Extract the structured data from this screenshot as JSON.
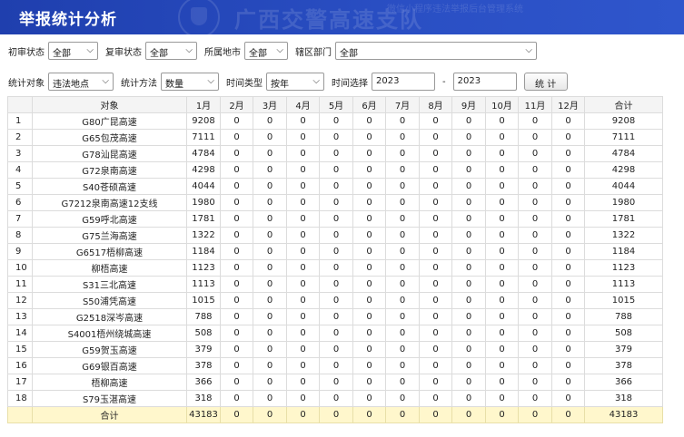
{
  "header": {
    "title": "举报统计分析",
    "watermark": "广西交警高速支队",
    "watermark_sub": "微信小程序违法举报后台管理系统"
  },
  "filters": {
    "initial_review_label": "初审状态",
    "initial_review_value": "全部",
    "re_review_label": "复审状态",
    "re_review_value": "全部",
    "city_label": "所属地市",
    "city_value": "全部",
    "dept_label": "辖区部门",
    "dept_value": "全部",
    "object_label": "统计对象",
    "object_value": "违法地点",
    "method_label": "统计方法",
    "method_value": "数量",
    "time_type_label": "时间类型",
    "time_type_value": "按年",
    "time_select_label": "时间选择",
    "time_from": "2023",
    "time_separator": "-",
    "time_to": "2023",
    "stat_button": "统 计"
  },
  "table": {
    "headers": [
      "",
      "对象",
      "1月",
      "2月",
      "3月",
      "4月",
      "5月",
      "6月",
      "7月",
      "8月",
      "9月",
      "10月",
      "11月",
      "12月",
      "合计"
    ],
    "rows": [
      [
        "1",
        "G80广昆高速",
        "9208",
        "0",
        "0",
        "0",
        "0",
        "0",
        "0",
        "0",
        "0",
        "0",
        "0",
        "0",
        "9208"
      ],
      [
        "2",
        "G65包茂高速",
        "7111",
        "0",
        "0",
        "0",
        "0",
        "0",
        "0",
        "0",
        "0",
        "0",
        "0",
        "0",
        "7111"
      ],
      [
        "3",
        "G78汕昆高速",
        "4784",
        "0",
        "0",
        "0",
        "0",
        "0",
        "0",
        "0",
        "0",
        "0",
        "0",
        "0",
        "4784"
      ],
      [
        "4",
        "G72泉南高速",
        "4298",
        "0",
        "0",
        "0",
        "0",
        "0",
        "0",
        "0",
        "0",
        "0",
        "0",
        "0",
        "4298"
      ],
      [
        "5",
        "S40苍硕高速",
        "4044",
        "0",
        "0",
        "0",
        "0",
        "0",
        "0",
        "0",
        "0",
        "0",
        "0",
        "0",
        "4044"
      ],
      [
        "6",
        "G7212泉南高速12支线",
        "1980",
        "0",
        "0",
        "0",
        "0",
        "0",
        "0",
        "0",
        "0",
        "0",
        "0",
        "0",
        "1980"
      ],
      [
        "7",
        "G59呼北高速",
        "1781",
        "0",
        "0",
        "0",
        "0",
        "0",
        "0",
        "0",
        "0",
        "0",
        "0",
        "0",
        "1781"
      ],
      [
        "8",
        "G75兰海高速",
        "1322",
        "0",
        "0",
        "0",
        "0",
        "0",
        "0",
        "0",
        "0",
        "0",
        "0",
        "0",
        "1322"
      ],
      [
        "9",
        "G6517梧柳高速",
        "1184",
        "0",
        "0",
        "0",
        "0",
        "0",
        "0",
        "0",
        "0",
        "0",
        "0",
        "0",
        "1184"
      ],
      [
        "10",
        "柳梧高速",
        "1123",
        "0",
        "0",
        "0",
        "0",
        "0",
        "0",
        "0",
        "0",
        "0",
        "0",
        "0",
        "1123"
      ],
      [
        "11",
        "S31三北高速",
        "1113",
        "0",
        "0",
        "0",
        "0",
        "0",
        "0",
        "0",
        "0",
        "0",
        "0",
        "0",
        "1113"
      ],
      [
        "12",
        "S50浦凭高速",
        "1015",
        "0",
        "0",
        "0",
        "0",
        "0",
        "0",
        "0",
        "0",
        "0",
        "0",
        "0",
        "1015"
      ],
      [
        "13",
        "G2518深岑高速",
        "788",
        "0",
        "0",
        "0",
        "0",
        "0",
        "0",
        "0",
        "0",
        "0",
        "0",
        "0",
        "788"
      ],
      [
        "14",
        "S4001梧州绕城高速",
        "508",
        "0",
        "0",
        "0",
        "0",
        "0",
        "0",
        "0",
        "0",
        "0",
        "0",
        "0",
        "508"
      ],
      [
        "15",
        "G59贺玉高速",
        "379",
        "0",
        "0",
        "0",
        "0",
        "0",
        "0",
        "0",
        "0",
        "0",
        "0",
        "0",
        "379"
      ],
      [
        "16",
        "G69银百高速",
        "378",
        "0",
        "0",
        "0",
        "0",
        "0",
        "0",
        "0",
        "0",
        "0",
        "0",
        "0",
        "378"
      ],
      [
        "17",
        "梧柳高速",
        "366",
        "0",
        "0",
        "0",
        "0",
        "0",
        "0",
        "0",
        "0",
        "0",
        "0",
        "0",
        "366"
      ],
      [
        "18",
        "S79玉湛高速",
        "318",
        "0",
        "0",
        "0",
        "0",
        "0",
        "0",
        "0",
        "0",
        "0",
        "0",
        "0",
        "318"
      ]
    ],
    "total_row": [
      "",
      "合计",
      "43183",
      "0",
      "0",
      "0",
      "0",
      "0",
      "0",
      "0",
      "0",
      "0",
      "0",
      "0",
      "43183"
    ]
  }
}
